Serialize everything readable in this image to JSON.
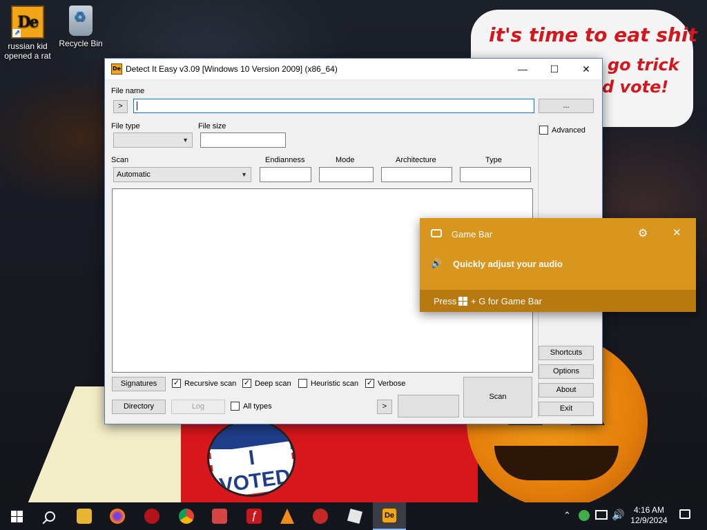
{
  "desktop": {
    "icons": [
      {
        "label_line1": "russian kid",
        "label_line2": "opened a rat"
      },
      {
        "label_line1": "Recycle Bin",
        "label_line2": ""
      }
    ],
    "wallpaper": {
      "speech_line1": "it's time to eat shit",
      "speech_line2": "go trick",
      "speech_line3": "d vote!",
      "badge_text": "I VOTED"
    }
  },
  "window": {
    "title": "Detect It Easy v3.09 [Windows 10 Version 2009] (x86_64)",
    "icon_text": "De",
    "file_name_label": "File name",
    "file_name_value": "",
    "browse_prev_label": ">",
    "browse_label": "...",
    "file_type_label": "File type",
    "file_type_value": "",
    "file_size_label": "File size",
    "file_size_value": "",
    "advanced_label": "Advanced",
    "advanced_checked": false,
    "scan_label": "Scan",
    "scan_mode_value": "Automatic",
    "columns": [
      "Endianness",
      "Mode",
      "Architecture",
      "Type"
    ],
    "column_values": [
      "",
      "",
      "",
      ""
    ],
    "buttons": {
      "signatures": "Signatures",
      "directory": "Directory",
      "log": "Log",
      "scan": "Scan",
      "next": ">",
      "shortcuts": "Shortcuts",
      "options": "Options",
      "about": "About",
      "exit": "Exit"
    },
    "checks": {
      "recursive": {
        "label": "Recursive scan",
        "checked": true
      },
      "deep": {
        "label": "Deep scan",
        "checked": true
      },
      "heuristic": {
        "label": "Heuristic scan",
        "checked": false
      },
      "verbose": {
        "label": "Verbose",
        "checked": true
      },
      "all_types": {
        "label": "All types",
        "checked": false
      }
    }
  },
  "gamebar": {
    "title": "Game Bar",
    "message": "Quickly adjust your audio",
    "footer_prefix": "Press",
    "footer_suffix": "+ G for Game Bar",
    "accent": "#d9961e"
  },
  "taskbar": {
    "time": "4:16 AM",
    "date": "12/9/2024",
    "apps": [
      "windows-start",
      "search",
      "file-explorer",
      "firefox",
      "app-red",
      "chrome",
      "app-game",
      "flash",
      "vlc",
      "app-roblox-like",
      "roblox",
      "detect-it-easy"
    ]
  }
}
